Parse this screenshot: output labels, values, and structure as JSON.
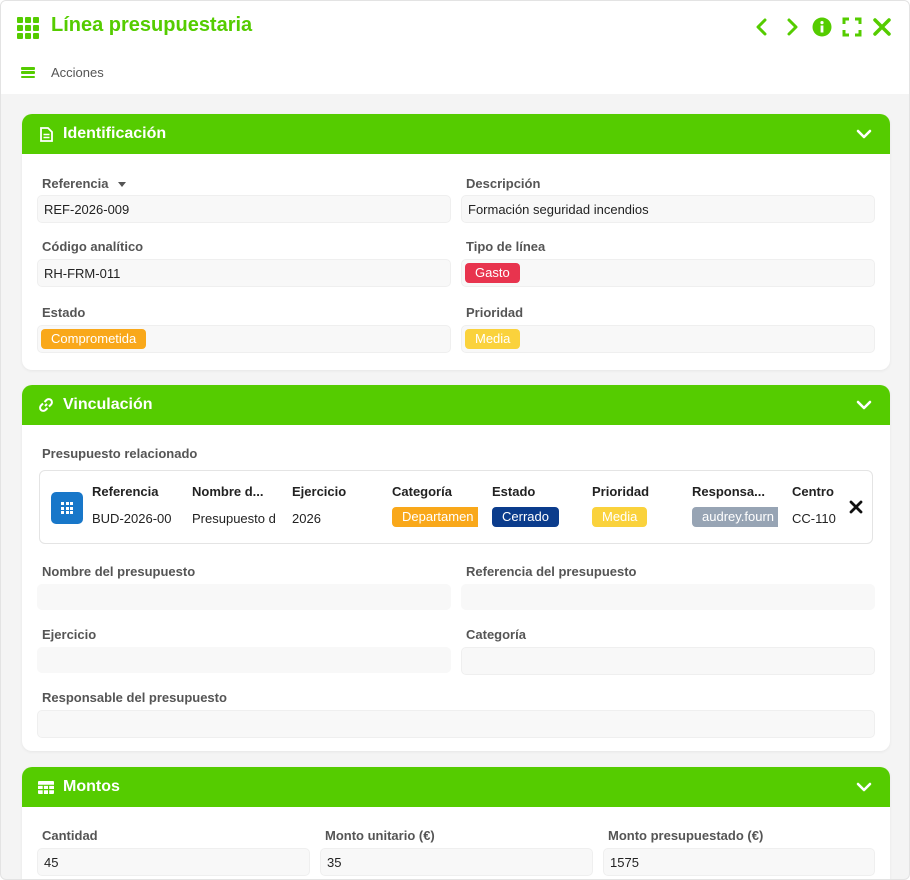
{
  "header": {
    "title": "Línea presupuestaria",
    "app_icon": "grid-icon",
    "actions": [
      "chevron-left-icon",
      "chevron-right-icon",
      "info-icon",
      "fullscreen-icon",
      "close-icon"
    ]
  },
  "toolbar": {
    "actions_label": "Acciones"
  },
  "colors": {
    "accent": "#55cc00",
    "danger": "#e8344e",
    "warning": "#f9a81a",
    "yellow": "#fad23c",
    "navy": "#0b3c8c",
    "grey": "#97a4b4",
    "blue": "#1877c9"
  },
  "identificacion": {
    "title": "Identificación",
    "fields": {
      "referencia": {
        "label": "Referencia",
        "value": "REF-2026-009"
      },
      "descripcion": {
        "label": "Descripción",
        "value": "Formación seguridad incendios"
      },
      "codigo": {
        "label": "Código analítico",
        "value": "RH-FRM-011"
      },
      "tipo": {
        "label": "Tipo de línea",
        "value": "Gasto"
      },
      "estado": {
        "label": "Estado",
        "value": "Comprometida"
      },
      "prioridad": {
        "label": "Prioridad",
        "value": "Media"
      }
    }
  },
  "vinculacion": {
    "title": "Vinculación",
    "related_label": "Presupuesto relacionado",
    "columns": [
      "Referencia",
      "Nombre d...",
      "Ejercicio",
      "Categoría",
      "Estado",
      "Prioridad",
      "Responsa...",
      "Centro"
    ],
    "row": [
      "BUD-2026-00",
      "Presupuesto d",
      "2026",
      "Departamen",
      "Cerrado",
      "Media",
      "audrey.fourn",
      "CC-110"
    ],
    "fields": {
      "nombre": {
        "label": "Nombre del presupuesto",
        "value": ""
      },
      "referencia": {
        "label": "Referencia del presupuesto",
        "value": ""
      },
      "ejercicio": {
        "label": "Ejercicio",
        "value": ""
      },
      "categoria": {
        "label": "Categoría",
        "value": ""
      },
      "responsable": {
        "label": "Responsable del presupuesto",
        "value": ""
      }
    }
  },
  "montos": {
    "title": "Montos",
    "fields": {
      "cantidad": {
        "label": "Cantidad",
        "value": "45"
      },
      "unitario": {
        "label": "Monto unitario (€)",
        "value": "35"
      },
      "presupuestado": {
        "label": "Monto presupuestado (€)",
        "value": "1575"
      }
    }
  }
}
